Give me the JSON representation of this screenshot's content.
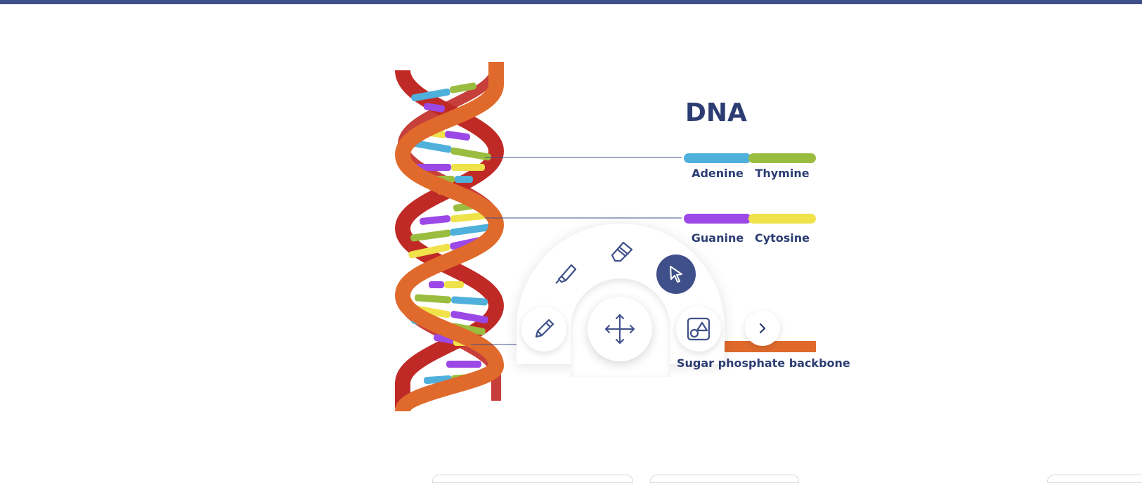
{
  "title": "DNA",
  "base_pairs": [
    {
      "left": "Adenine",
      "right": "Thymine",
      "left_color": "#4fb0dc",
      "right_color": "#9bbd3f"
    },
    {
      "left": "Guanine",
      "right": "Cytosine",
      "left_color": "#9b48e6",
      "right_color": "#f0e24a"
    }
  ],
  "backbone": {
    "label": "Sugar phosphate backbone",
    "color": "#e06a2c"
  },
  "colors": {
    "accent": "#3f4f8a",
    "text": "#2c3d73",
    "strand_red": "#c02a26",
    "strand_orange": "#e06a2c"
  },
  "tools": {
    "pencil": "pencil-icon",
    "highlighter": "highlighter-icon",
    "eraser": "eraser-icon",
    "select": "cursor-icon",
    "move": "move-icon",
    "shapes": "shapes-icon",
    "next": "chevron-right-icon"
  }
}
